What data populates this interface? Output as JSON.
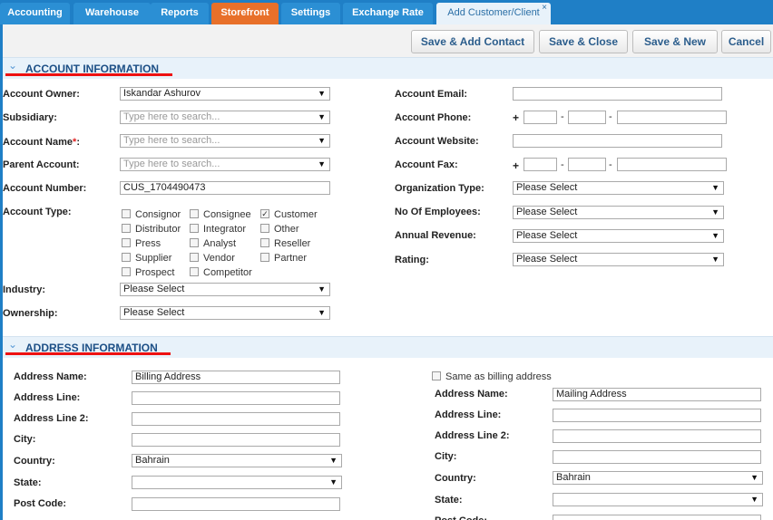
{
  "tabs": [
    "Accounting",
    "Warehouse",
    "Reports",
    "Storefront",
    "Settings",
    "Exchange Rate",
    "Add Customer/Client"
  ],
  "tab_close": "×",
  "toolbar": {
    "save_add_contact": "Save & Add Contact",
    "save_close": "Save & Close",
    "save_new": "Save & New",
    "cancel": "Cancel"
  },
  "account_section": {
    "title": "ACCOUNT INFORMATION",
    "account_owner_label": "Account Owner:",
    "account_owner_value": "Iskandar Ashurov",
    "subsidiary_label": "Subsidiary:",
    "search_placeholder": "Type here to search...",
    "account_name_label": "Account Name",
    "required_mark": "*",
    "colon": ":",
    "parent_account_label": "Parent Account:",
    "account_number_label": "Account Number:",
    "account_number_value": "CUS_1704490473",
    "account_type_label": "Account Type:",
    "account_types": [
      "Consignor",
      "Consignee",
      "Customer",
      "Distributor",
      "Integrator",
      "Other",
      "Press",
      "Analyst",
      "Reseller",
      "Supplier",
      "Vendor",
      "Partner",
      "Prospect",
      "Competitor"
    ],
    "checked_mark": "✓",
    "industry_label": "Industry:",
    "ownership_label": "Ownership:",
    "please_select": "Please Select",
    "account_email_label": "Account Email:",
    "account_phone_label": "Account Phone:",
    "account_website_label": "Account Website:",
    "account_fax_label": "Account Fax:",
    "plus": "+",
    "dash": "-",
    "organization_type_label": "Organization Type:",
    "no_of_employees_label": "No Of Employees:",
    "annual_revenue_label": "Annual Revenue:",
    "rating_label": "Rating:"
  },
  "address_section": {
    "title": "ADDRESS INFORMATION",
    "address_name_label": "Address Name:",
    "billing_name": "Billing Address",
    "mailing_name": "Mailing Address",
    "address_line_label": "Address Line:",
    "address_line2_label": "Address Line 2:",
    "city_label": "City:",
    "country_label": "Country:",
    "country_value": "Bahrain",
    "state_label": "State:",
    "post_code_label": "Post Code:",
    "same_as_billing": "Same as billing address"
  },
  "icons": {
    "dropdown": "▼",
    "collapse": "⌄"
  },
  "colors": {
    "tab_bar": "#1f7fc6",
    "tab_orange": "#e8702a",
    "section_title": "#1c4f86",
    "annotation_red": "#e11111"
  }
}
